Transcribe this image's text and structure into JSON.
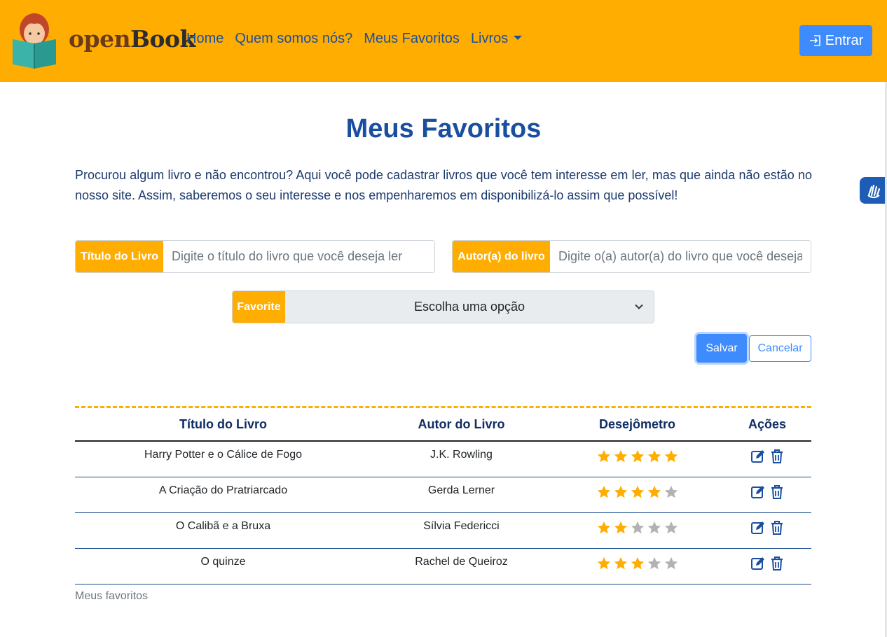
{
  "brand": {
    "name_part1": "open",
    "name_part2": "Book"
  },
  "nav": {
    "items": [
      "Home",
      "Quem somos nós?",
      "Meus Favoritos"
    ],
    "dropdown_label": "Livros",
    "login_label": "Entrar"
  },
  "page": {
    "title": "Meus Favoritos",
    "intro": "Procurou algum livro e não encontrou? Aqui você pode cadastrar livros que você tem interesse em ler, mas que ainda não estão no nosso site. Assim, saberemos o seu interesse e nos empenharemos em disponibilizá-lo assim que possível!"
  },
  "form": {
    "title_label": "Título do Livro",
    "title_placeholder": "Digite o título do livro que você deseja ler",
    "author_label": "Autor(a) do livro",
    "author_placeholder": "Digite o(a) autor(a) do livro que você deseja ler",
    "favorite_label": "Favorite",
    "favorite_selected": "Escolha uma opção",
    "save_label": "Salvar",
    "cancel_label": "Cancelar"
  },
  "table": {
    "headers": [
      "Título do Livro",
      "Autor do Livro",
      "Desejômetro",
      "Ações"
    ],
    "rows": [
      {
        "title": "Harry Potter e o Cálice de Fogo",
        "author": "J.K. Rowling",
        "rating": 5
      },
      {
        "title": "A Criação do Pratriarcado",
        "author": "Gerda Lerner",
        "rating": 4
      },
      {
        "title": "O Calibã e a Bruxa",
        "author": "Sílvia Federicci",
        "rating": 2
      },
      {
        "title": "O quinze",
        "author": "Rachel de Queiroz",
        "rating": 3
      }
    ],
    "max_rating": 5,
    "caption": "Meus favoritos"
  },
  "colors": {
    "brand_orange": "#ffad00",
    "primary_blue": "#3d8bfd",
    "title_blue": "#1a4fa0",
    "star_filled": "#ffad00",
    "star_empty": "#b3b3b3",
    "icon_blue": "#1a4fa0"
  },
  "icons": {
    "login": "login-icon",
    "dropdown": "chevron-down-icon",
    "edit": "edit-icon",
    "delete": "trash-icon",
    "accessibility": "sign-language-icon"
  }
}
